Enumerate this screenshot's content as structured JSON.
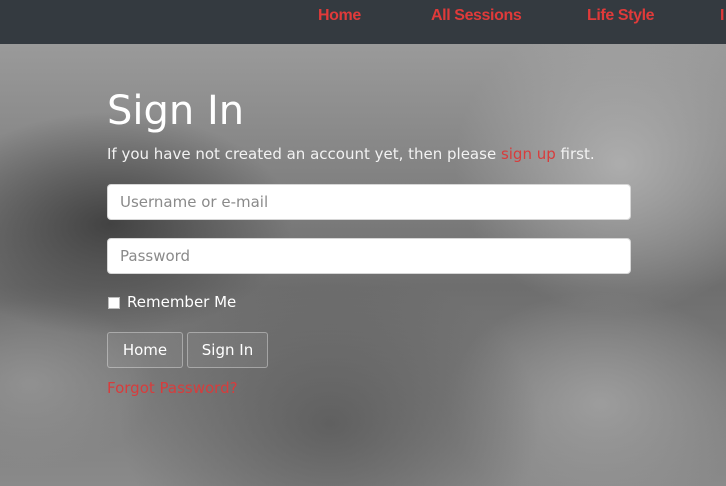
{
  "nav": {
    "items": [
      "Home",
      "All Sessions",
      "Life Style",
      "I"
    ]
  },
  "signin": {
    "title": "Sign In",
    "subtitle_before": "If you have not created an account yet, then please ",
    "subtitle_link": "sign up",
    "subtitle_after": " first.",
    "username_placeholder": "Username or e-mail",
    "password_placeholder": "Password",
    "remember_label": "Remember Me",
    "remember_checked": false,
    "home_button": "Home",
    "signin_button": "Sign In",
    "forgot_link": "Forgot Password?"
  },
  "colors": {
    "nav_bg": "#343a40",
    "accent": "#e03a3a"
  }
}
